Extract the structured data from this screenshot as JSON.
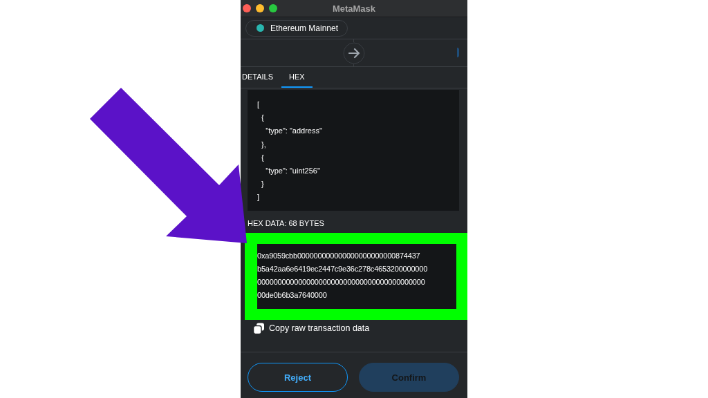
{
  "window": {
    "title": "MetaMask"
  },
  "network": {
    "name": "Ethereum Mainnet",
    "color": "#29b6af"
  },
  "tabs": [
    {
      "label": "DETAILS",
      "selected": false
    },
    {
      "label": "HEX",
      "selected": true
    }
  ],
  "code_lines": [
    "[",
    "  {",
    "    \"type\": \"address\"",
    "  },",
    "  {",
    "    \"type\": \"uint256\"",
    "  }",
    "]"
  ],
  "hex_label": "HEX DATA: 68 BYTES",
  "hex_lines": [
    "0xa9059cbb000000000000000000000000874437",
    "b5a42aa6e6419ec2447c9e36c278c4653200000000",
    "00000000000000000000000000000000000000000",
    "00de0b6b3a7640000"
  ],
  "copy_label": "Copy raw transaction data",
  "buttons": [
    {
      "label": "Reject",
      "kind": "secondary",
      "disabled": false
    },
    {
      "label": "Confirm",
      "kind": "primary",
      "disabled": true
    }
  ]
}
